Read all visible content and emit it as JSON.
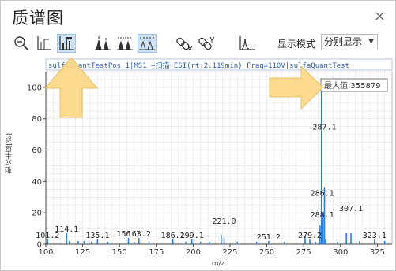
{
  "window": {
    "title": "质谱图",
    "close_glyph": "×"
  },
  "toolbar": {
    "buttons": [
      {
        "id": "zoom-reset",
        "icon": "magnifier-minus-icon"
      },
      {
        "id": "line-spectrum",
        "icon": "line-spectrum-icon"
      },
      {
        "id": "bar-spectrum",
        "icon": "bar-spectrum-icon",
        "active": true
      },
      {
        "id": "peak-labels-1",
        "icon": "peak-label-icon"
      },
      {
        "id": "peak-labels-2",
        "icon": "peak-label-alt-icon"
      },
      {
        "id": "peak-labels-3",
        "icon": "peak-label-dashed-icon",
        "active": true
      },
      {
        "id": "unlink",
        "icon": "unlink-icon"
      },
      {
        "id": "link",
        "icon": "link-icon"
      },
      {
        "id": "profile",
        "icon": "profile-curve-icon"
      }
    ],
    "display_mode_label": "显示模式",
    "display_mode_value": "分别显示",
    "dropdown_glyph": "▼"
  },
  "header_text": "sulfaQuantTestPos_1|MS1 +扫描 ESI(rt:2.119min) Frag=110V|sulfaQuantTest",
  "max_value_label": "最大值:355879",
  "colors": {
    "peak": "#2e7fd6",
    "grid": "#e3e3e3",
    "arrow_fill": "#fcd98a",
    "arrow_stroke": "#e9bf5f",
    "header_text": "#2a5db0",
    "active_bg": "#cfe3f7"
  },
  "chart_data": {
    "type": "bar",
    "xlabel": "m/z",
    "ylabel": "相对丰度[%]",
    "xlim": [
      100,
      335
    ],
    "ylim": [
      0,
      110
    ],
    "xticks": [
      100,
      125,
      150,
      175,
      200,
      225,
      250,
      275,
      300,
      325
    ],
    "yticks": [
      0,
      20,
      40,
      60,
      80,
      100
    ],
    "peaks": [
      {
        "x": 101.2,
        "y": 3
      },
      {
        "x": 114.1,
        "y": 7
      },
      {
        "x": 116.0,
        "y": 2
      },
      {
        "x": 122.0,
        "y": 2
      },
      {
        "x": 126.0,
        "y": 2
      },
      {
        "x": 131.0,
        "y": 1.5
      },
      {
        "x": 135.1,
        "y": 3
      },
      {
        "x": 142.0,
        "y": 1.5
      },
      {
        "x": 156.1,
        "y": 4
      },
      {
        "x": 160.0,
        "y": 1.5
      },
      {
        "x": 163.2,
        "y": 4
      },
      {
        "x": 170.0,
        "y": 1.5
      },
      {
        "x": 186.2,
        "y": 3
      },
      {
        "x": 195.0,
        "y": 1.5
      },
      {
        "x": 199.1,
        "y": 3
      },
      {
        "x": 205.0,
        "y": 1.5
      },
      {
        "x": 211.0,
        "y": 1.5
      },
      {
        "x": 219.0,
        "y": 6
      },
      {
        "x": 221.0,
        "y": 4
      },
      {
        "x": 230.0,
        "y": 1.5
      },
      {
        "x": 243.0,
        "y": 1.5
      },
      {
        "x": 251.2,
        "y": 2
      },
      {
        "x": 262.0,
        "y": 1.5
      },
      {
        "x": 276.0,
        "y": 5
      },
      {
        "x": 279.2,
        "y": 3
      },
      {
        "x": 283.0,
        "y": 1.5
      },
      {
        "x": 286.1,
        "y": 12
      },
      {
        "x": 287.1,
        "y": 100
      },
      {
        "x": 288.1,
        "y": 20
      },
      {
        "x": 289.1,
        "y": 36
      },
      {
        "x": 290.0,
        "y": 3
      },
      {
        "x": 298.0,
        "y": 1.5
      },
      {
        "x": 304.0,
        "y": 7
      },
      {
        "x": 307.1,
        "y": 7
      },
      {
        "x": 313.0,
        "y": 2
      },
      {
        "x": 323.1,
        "y": 3
      },
      {
        "x": 330.0,
        "y": 2
      }
    ],
    "labels": [
      {
        "text": "101.2",
        "x": 101.2,
        "y": 3
      },
      {
        "text": "114.1",
        "x": 114.1,
        "y": 7
      },
      {
        "text": "135.1",
        "x": 135.1,
        "y": 3
      },
      {
        "text": "156.1",
        "x": 156.1,
        "y": 4
      },
      {
        "text": "163.2",
        "x": 163.2,
        "y": 4
      },
      {
        "text": "186.2",
        "x": 186.2,
        "y": 3
      },
      {
        "text": "199.1",
        "x": 199.1,
        "y": 3
      },
      {
        "text": "221.0",
        "x": 221.0,
        "y": 12
      },
      {
        "text": "251.2",
        "x": 251.2,
        "y": 2
      },
      {
        "text": "279.2",
        "x": 279.2,
        "y": 3
      },
      {
        "text": "287.1",
        "x": 289.1,
        "y": 72
      },
      {
        "text": "286.1",
        "x": 287.6,
        "y": 30
      },
      {
        "text": "288.1",
        "x": 287.6,
        "y": 16
      },
      {
        "text": "307.1",
        "x": 307.1,
        "y": 20
      },
      {
        "text": "323.1",
        "x": 323.1,
        "y": 3
      }
    ]
  }
}
